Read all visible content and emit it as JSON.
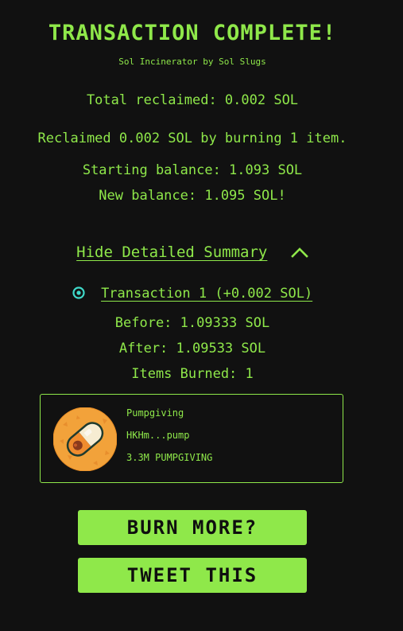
{
  "header": {
    "title": "TRANSACTION COMPLETE!",
    "subtitle": "Sol Incinerator by Sol Slugs"
  },
  "summary": {
    "total_reclaimed": "Total reclaimed: 0.002 SOL",
    "reclaimed_message": "Reclaimed 0.002 SOL by burning 1 item.",
    "starting_balance": "Starting balance: 1.093 SOL",
    "new_balance": "New balance: 1.095 SOL!"
  },
  "details": {
    "toggle_label": "Hide Detailed Summary",
    "transaction": {
      "label": "Transaction 1 (+0.002 SOL)",
      "before": "Before: 1.09333 SOL",
      "after": "After: 1.09533 SOL",
      "items_burned": "Items Burned: 1"
    },
    "item": {
      "name": "Pumpgiving",
      "address": "HKHm...pump",
      "amount": "3.3M PUMPGIVING"
    }
  },
  "actions": {
    "burn_more": "BURN MORE?",
    "tweet": "TWEET THIS"
  },
  "colors": {
    "background": "#111111",
    "accent": "#8fe84a",
    "status_dot": "#3fd9c9"
  }
}
